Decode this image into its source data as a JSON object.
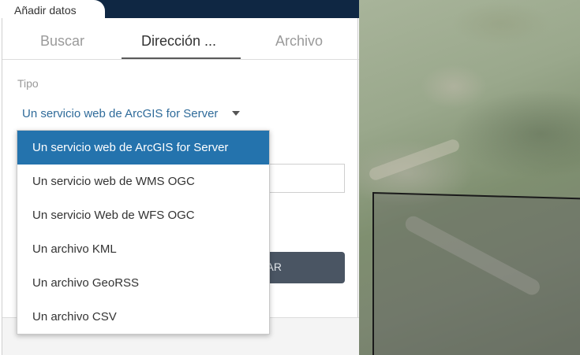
{
  "panel": {
    "title": "Añadir datos",
    "tabs": [
      {
        "label": "Buscar",
        "active": false
      },
      {
        "label": "Dirección ...",
        "active": true
      },
      {
        "label": "Archivo",
        "active": false
      }
    ],
    "type_label": "Tipo",
    "selected_type": "Un servicio web de ArcGIS for Server",
    "add_button_partial": "AR"
  },
  "dropdown": {
    "options": [
      {
        "label": "Un servicio web de ArcGIS for Server",
        "selected": true
      },
      {
        "label": "Un servicio web de WMS OGC",
        "selected": false
      },
      {
        "label": "Un servicio Web de WFS OGC",
        "selected": false
      },
      {
        "label": "Un archivo KML",
        "selected": false
      },
      {
        "label": "Un archivo GeoRSS",
        "selected": false
      },
      {
        "label": "Un archivo CSV",
        "selected": false
      }
    ]
  },
  "colors": {
    "header_dark": "#0f2743",
    "select_text": "#2f6b9a",
    "option_selected_bg": "#2473ad",
    "button_bg": "#4a5563"
  }
}
